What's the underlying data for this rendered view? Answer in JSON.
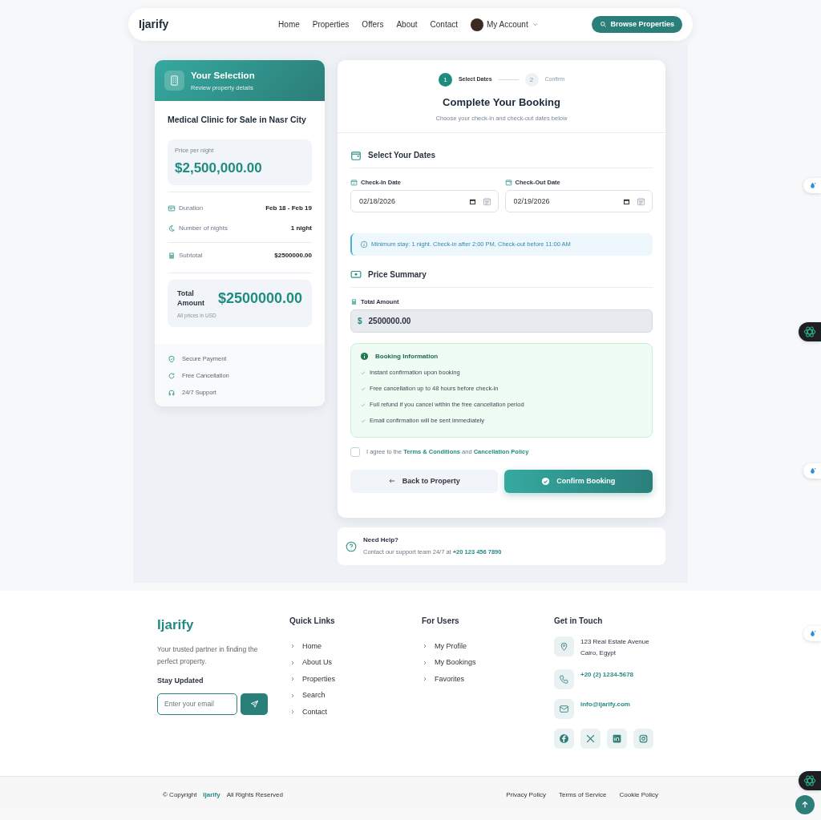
{
  "navbar": {
    "brand": "Ijarify",
    "links": [
      {
        "label": "Home"
      },
      {
        "label": "Properties"
      },
      {
        "label": "Offers"
      },
      {
        "label": "About"
      },
      {
        "label": "Contact"
      }
    ],
    "account": "My Account",
    "browse_button": "Browse Properties"
  },
  "selection": {
    "title": "Your Selection",
    "subtitle": "Review property details",
    "property_name": "Medical Clinic for Sale in Nasr City",
    "price_label": "Price per night",
    "price": "$2,500,000.00",
    "details": [
      {
        "kind": "duration",
        "label": "Duration",
        "value": "Feb 18 - Feb 19"
      },
      {
        "kind": "nights",
        "label": "Number of nights",
        "value": "1 night"
      },
      {
        "kind": "subtotal",
        "label": "Subtotal",
        "value": "$2500000.00"
      }
    ],
    "total_label": "Total Amount",
    "total": "$2500000.00",
    "currency_note": "All prices in USD",
    "features": [
      {
        "kind": "shield",
        "label": "Secure Payment"
      },
      {
        "kind": "refresh",
        "label": "Free Cancellation"
      },
      {
        "kind": "headset",
        "label": "24/7 Support"
      }
    ]
  },
  "booking": {
    "steps": [
      {
        "number": "1",
        "label": "Select Dates",
        "selected": true
      },
      {
        "number": "2",
        "label": "Confirm",
        "selected": false
      }
    ],
    "title": "Complete Your Booking",
    "subtitle": "Choose your check-in and check-out dates below",
    "dates_title": "Select Your Dates",
    "dates": [
      {
        "label": "Check-In Date",
        "value": "02/18/2026"
      },
      {
        "label": "Check-Out Date",
        "value": "02/19/2026"
      }
    ],
    "notice": "Minimum stay: 1 night. Check-in after 2:00 PM, Check-out before 11:00 AM",
    "price_title": "Price Summary",
    "total_label": "Total Amount",
    "currency_symbol": "$",
    "total_value": "2500000.00",
    "info_title": "Booking Information",
    "info_items": [
      "Instant confirmation upon booking",
      "Free cancellation up to 48 hours before check-in",
      "Full refund if you cancel within the free cancellation period",
      "Email confirmation will be sent immediately"
    ],
    "agreement": {
      "checked": false,
      "parts": [
        {
          "kind": "text",
          "text": "I agree to the "
        },
        {
          "kind": "link",
          "text": "Terms & Conditions"
        },
        {
          "kind": "text",
          "text": " and "
        },
        {
          "kind": "link",
          "text": "Cancellation Policy"
        }
      ]
    },
    "back_button": "Back to Property",
    "confirm_button": "Confirm Booking"
  },
  "help": {
    "title": "Need Help?",
    "text": "Contact our support team 24/7 at ",
    "phone": "+20 123 456 7890"
  },
  "footer": {
    "brand": "Ijarify",
    "tagline": "Your trusted partner in finding the perfect property.",
    "newsletter_title": "Stay Updated",
    "email_placeholder": "Enter your email",
    "quick_links_title": "Quick Links",
    "quick_links": [
      "Home",
      "About Us",
      "Properties",
      "Search",
      "Contact"
    ],
    "users_title": "For Users",
    "users_links": [
      "My Profile",
      "My Bookings",
      "Favorites"
    ],
    "contact_title": "Get in Touch",
    "contacts": [
      {
        "kind": "location",
        "lines": [
          "123 Real Estate Avenue",
          "Cairo, Egypt"
        ]
      },
      {
        "kind": "phone",
        "lines": [
          "+20 (2) 1234-5678"
        ]
      },
      {
        "kind": "email",
        "lines": [
          "info@ijarify.com"
        ]
      }
    ],
    "social": [
      {
        "kind": "facebook"
      },
      {
        "kind": "x"
      },
      {
        "kind": "linkedin"
      },
      {
        "kind": "instagram"
      }
    ],
    "copyright": {
      "prefix": "© Copyright",
      "brand": "Ijarify",
      "suffix": "All Rights Reserved"
    },
    "legal_links": [
      "Privacy Policy",
      "Terms of Service",
      "Cookie Policy"
    ]
  },
  "side_widgets": [
    {
      "kind": "drop"
    },
    {
      "kind": "atom"
    },
    {
      "kind": "drop"
    },
    {
      "kind": "drop"
    },
    {
      "kind": "atom"
    }
  ]
}
